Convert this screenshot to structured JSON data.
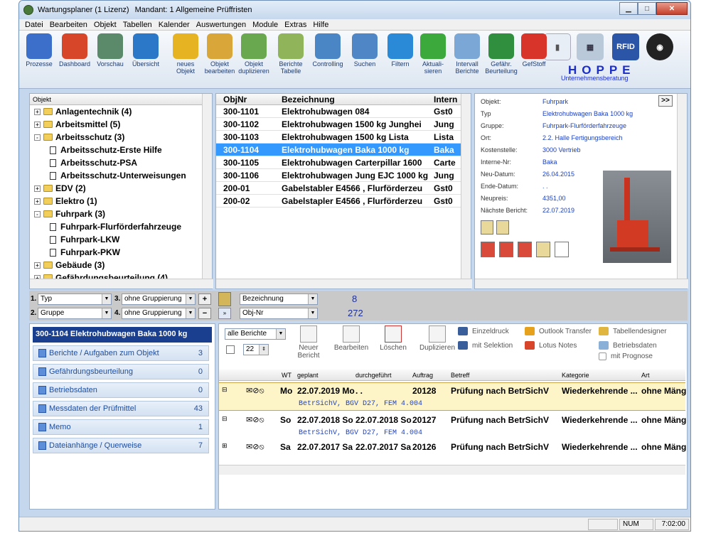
{
  "window": {
    "title": "Wartungsplaner  (1 Lizenz)",
    "mandant": "Mandant: 1 Allgemeine Prüffristen"
  },
  "menu": [
    "Datei",
    "Bearbeiten",
    "Objekt",
    "Tabellen",
    "Kalender",
    "Auswertungen",
    "Module",
    "Extras",
    "Hilfe"
  ],
  "toolbar": [
    {
      "label": "Prozesse",
      "icon": "processes-icon",
      "color": "#3b6fc9"
    },
    {
      "label": "Dashboard",
      "icon": "dashboard-chart-icon",
      "color": "#d8462a"
    },
    {
      "label": "Vorschau",
      "icon": "preview-clock-icon",
      "color": "#5b8a6a"
    },
    {
      "label": "Übersicht",
      "icon": "overview-list-icon",
      "color": "#2c78c8"
    },
    {
      "label": "neues Objekt",
      "icon": "new-object-pencil-icon",
      "color": "#e6b422"
    },
    {
      "label": "Objekt bearbeiten",
      "icon": "edit-object-pencil-icon",
      "color": "#d9a63a"
    },
    {
      "label": "Objekt duplizieren",
      "icon": "duplicate-object-icon",
      "color": "#6aa84f"
    },
    {
      "label": "Berichte Tabelle",
      "icon": "report-table-icon",
      "color": "#8fb45a"
    },
    {
      "label": "Controlling",
      "icon": "controlling-bars-icon",
      "color": "#4a86c5"
    },
    {
      "label": "Suchen",
      "icon": "search-icon",
      "color": "#4f86c6"
    },
    {
      "label": "Filtern",
      "icon": "filter-funnel-icon",
      "color": "#2b8ad8"
    },
    {
      "label": "Aktuali- sieren",
      "icon": "refresh-arrows-icon",
      "color": "#3ca93c"
    },
    {
      "label": "Intervall Berichte",
      "icon": "interval-reports-icon",
      "color": "#7aa7d6"
    },
    {
      "label": "Gefähr. Beurteilung",
      "icon": "risk-checklist-icon",
      "color": "#2f8f3f"
    },
    {
      "label": "GefStoff",
      "icon": "hazard-diamond-icon",
      "color": "#d9342a"
    }
  ],
  "toolbar_right": {
    "rfid": "RFID",
    "brand": "HOPPE",
    "brand_sub": "Unternehmensberatung"
  },
  "tree": {
    "header": "Objekt",
    "items": [
      {
        "label": "Anlagentechnik  (4)",
        "level": 0,
        "type": "folder",
        "pm": "+"
      },
      {
        "label": "Arbeitsmittel  (5)",
        "level": 0,
        "type": "folder",
        "pm": "+"
      },
      {
        "label": "Arbeitsschutz  (3)",
        "level": 0,
        "type": "folder-open",
        "pm": "-"
      },
      {
        "label": "Arbeitsschutz-Erste Hilfe",
        "level": 1,
        "type": "doc"
      },
      {
        "label": "Arbeitsschutz-PSA",
        "level": 1,
        "type": "doc"
      },
      {
        "label": "Arbeitsschutz-Unterweisungen",
        "level": 1,
        "type": "doc"
      },
      {
        "label": "EDV  (2)",
        "level": 0,
        "type": "folder",
        "pm": "+"
      },
      {
        "label": "Elektro  (1)",
        "level": 0,
        "type": "folder",
        "pm": "+"
      },
      {
        "label": "Fuhrpark  (3)",
        "level": 0,
        "type": "folder-open",
        "pm": "-"
      },
      {
        "label": "Fuhrpark-Flurförderfahrzeuge",
        "level": 1,
        "type": "doc"
      },
      {
        "label": "Fuhrpark-LKW",
        "level": 1,
        "type": "doc"
      },
      {
        "label": "Fuhrpark-PKW",
        "level": 1,
        "type": "doc"
      },
      {
        "label": "Gebäude  (3)",
        "level": 0,
        "type": "folder",
        "pm": "+"
      },
      {
        "label": "Gefährdungsbeurteilung  (4)",
        "level": 0,
        "type": "folder",
        "pm": "+"
      }
    ]
  },
  "grid": {
    "headers": [
      "ObjNr",
      "Bezeichnung",
      "Intern"
    ],
    "rows": [
      {
        "objnr": "300-1101",
        "bez": "Elektrohubwagen 084",
        "intern": "Gst0"
      },
      {
        "objnr": "300-1102",
        "bez": "Elektrohubwagen 1500 kg  Junghei",
        "intern": "Jung"
      },
      {
        "objnr": "300-1103",
        "bez": "Elektrohubwagen 1500 kg Lista",
        "intern": "Lista"
      },
      {
        "objnr": "300-1104",
        "bez": "Elektrohubwagen Baka 1000 kg",
        "intern": "Baka",
        "selected": true
      },
      {
        "objnr": "300-1105",
        "bez": "Elektrohubwagen Carterpillar 1600",
        "intern": "Carte"
      },
      {
        "objnr": "300-1106",
        "bez": "Elektrohubwagen Jung EJC 1000 kg",
        "intern": "Jung"
      },
      {
        "objnr": "200-01",
        "bez": "Gabelstabler E4566 , Flurförderzeu",
        "intern": "Gst0"
      },
      {
        "objnr": "200-02",
        "bez": "Gabelstapler E4566 , Flurförderzeu",
        "intern": "Gst0"
      }
    ]
  },
  "detail": {
    "fields": [
      {
        "label": "Objekt:",
        "value": "Fuhrpark"
      },
      {
        "label": "Typ",
        "value": "Elektrohubwagen Baka 1000 kg"
      },
      {
        "label": "Gruppe:",
        "value": "Fuhrpark-Flurförderfahrzeuge"
      },
      {
        "label": "Ort:",
        "value": "2.2. Halle Fertigungsbereich"
      },
      {
        "label": "Kostenstelle:",
        "value": "3000 Vertrieb"
      },
      {
        "label": "Interne-Nr:",
        "value": "Baka"
      },
      {
        "label": "Neu-Datum:",
        "value": "26.04.2015"
      },
      {
        "label": "Ende-Datum:",
        "value": " .  ."
      },
      {
        "label": "Neupreis:",
        "value": "4351,00"
      },
      {
        "label": "Nächste Bericht:",
        "value": "22.07.2019"
      }
    ],
    "nav_button": ">>"
  },
  "filters": {
    "f1": {
      "num": "1.",
      "value": "Typ"
    },
    "f2": {
      "num": "2.",
      "value": "Gruppe"
    },
    "f3": {
      "num": "3.",
      "value": "ohne Gruppierung"
    },
    "f4": {
      "num": "4.",
      "value": "ohne Gruppierung"
    },
    "sort1": "Bezeichnung",
    "sort2": "Obj-Nr",
    "count1": "8",
    "count2": "272"
  },
  "sidebar": {
    "header": "300-1104 Elektrohubwagen Baka 1000 kg",
    "items": [
      {
        "label": "Berichte / Aufgaben zum Objekt",
        "count": "3"
      },
      {
        "label": "Gefährdungsbeurteilung",
        "count": "0"
      },
      {
        "label": "Betriebsdaten",
        "count": "0"
      },
      {
        "label": "Messdaten der Prüfmittel",
        "count": "43"
      },
      {
        "label": "Memo",
        "count": "1"
      },
      {
        "label": "Dateianhänge / Querweise",
        "count": "7"
      }
    ]
  },
  "reports": {
    "filter": "alle Berichte",
    "days": "22",
    "actions": [
      "Neuer Bericht",
      "Bearbeiten",
      "Löschen",
      "Duplizieren"
    ],
    "print": [
      "Einzeldruck",
      "mit Selektion",
      "Outlook Transfer",
      "Lotus Notes",
      "Tabellendesigner",
      "Betriebsdaten",
      "mit Prognose"
    ],
    "headers": [
      "WT",
      "geplant",
      "durchgeführt",
      "Auftrag",
      "Betreff",
      "Kategorie",
      "Art"
    ],
    "rows": [
      {
        "wt": "Mo",
        "geplant": "22.07.2019 Mo",
        "durch": " .  .",
        "auftrag": "20128",
        "betreff": "Prüfung nach BetrSichV",
        "kategorie": "Wiederkehrende ...",
        "art": "ohne Mäng",
        "note": "BetrSichV, BGV D27, FEM 4.004",
        "highlight": true
      },
      {
        "wt": "So",
        "geplant": "22.07.2018 So",
        "durch": "22.07.2018 So",
        "auftrag": "20127",
        "betreff": "Prüfung nach BetrSichV",
        "kategorie": "Wiederkehrende ...",
        "art": "ohne Mäng",
        "note": "BetrSichV, BGV D27, FEM 4.004"
      },
      {
        "wt": "Sa",
        "geplant": "22.07.2017 Sa",
        "durch": "22.07.2017 Sa",
        "auftrag": "20126",
        "betreff": "Prüfung nach BetrSichV",
        "kategorie": "Wiederkehrende ...",
        "art": "ohne Mäng",
        "note": ""
      }
    ]
  },
  "status": {
    "num": "NUM",
    "time": "7:02:00"
  }
}
